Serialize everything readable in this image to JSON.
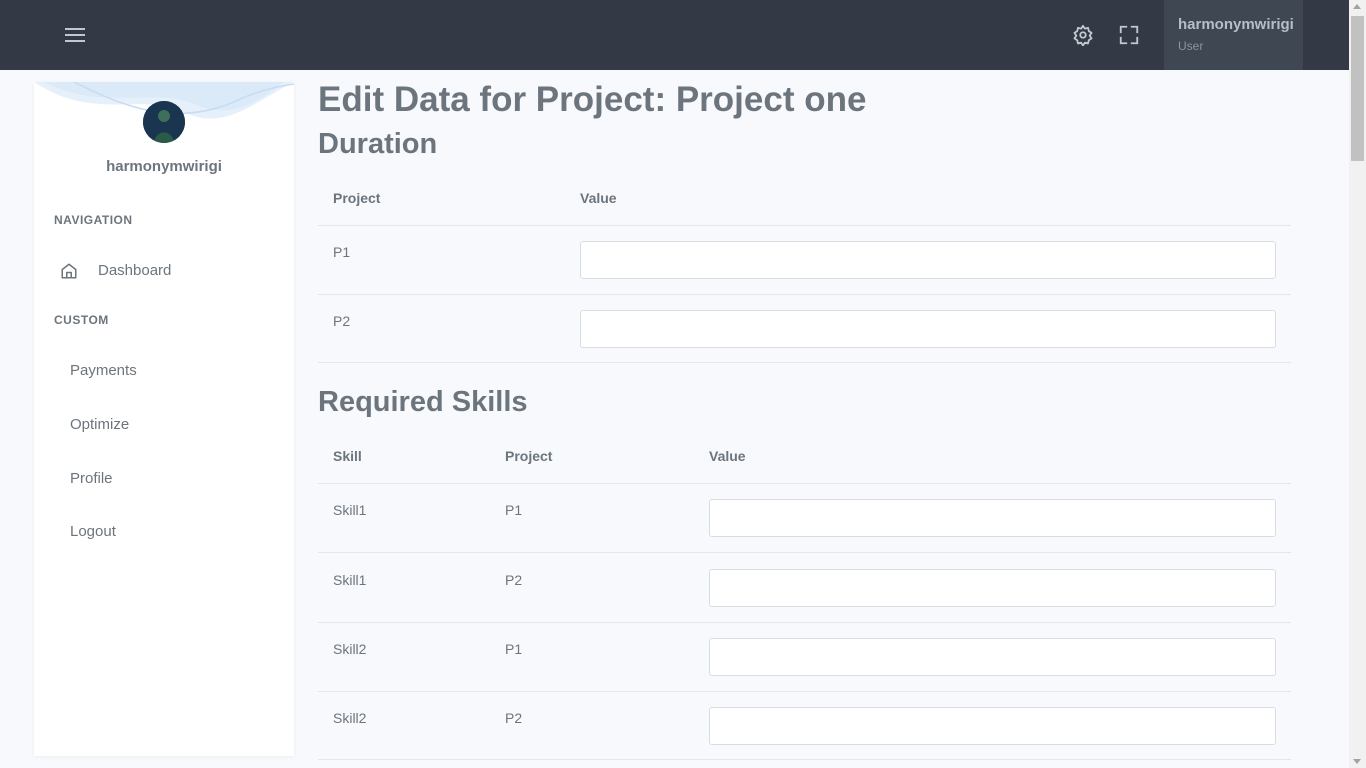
{
  "header": {
    "user_name": "harmonymwirigi",
    "user_role": "User"
  },
  "sidebar": {
    "user_name": "harmonymwirigi",
    "navigation_heading": "NAVIGATION",
    "dashboard_label": "Dashboard",
    "custom_heading": "CUSTOM",
    "items": [
      {
        "label": "Payments"
      },
      {
        "label": "Optimize"
      },
      {
        "label": "Profile"
      },
      {
        "label": "Logout"
      }
    ]
  },
  "main": {
    "title": "Edit Data for Project: Project one",
    "duration": {
      "heading": "Duration",
      "columns": [
        "Project",
        "Value"
      ],
      "rows": [
        {
          "project": "P1",
          "value": ""
        },
        {
          "project": "P2",
          "value": ""
        }
      ]
    },
    "skills": {
      "heading": "Required Skills",
      "columns": [
        "Skill",
        "Project",
        "Value"
      ],
      "rows": [
        {
          "skill": "Skill1",
          "project": "P1",
          "value": ""
        },
        {
          "skill": "Skill1",
          "project": "P2",
          "value": ""
        },
        {
          "skill": "Skill2",
          "project": "P1",
          "value": ""
        },
        {
          "skill": "Skill2",
          "project": "P2",
          "value": ""
        }
      ]
    }
  },
  "colors": {
    "topbar": "#333a45",
    "background": "#f7f9fc",
    "text": "#6c757d"
  }
}
